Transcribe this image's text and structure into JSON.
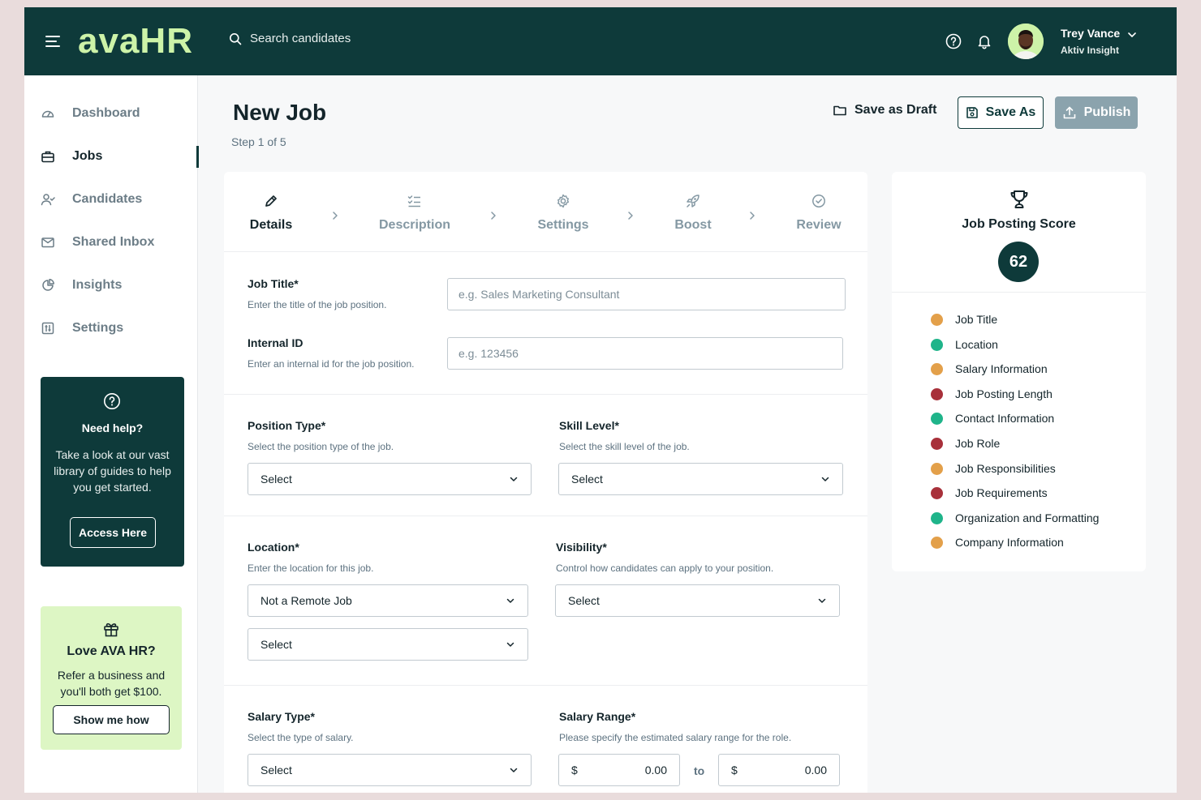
{
  "app": {
    "logo": "avaHR"
  },
  "header": {
    "search_placeholder": "Search candidates",
    "user": {
      "name": "Trey Vance",
      "org": "Aktiv Insight"
    }
  },
  "sidebar": {
    "items": [
      {
        "label": "Dashboard",
        "icon": "gauge-icon"
      },
      {
        "label": "Jobs",
        "icon": "briefcase-icon",
        "active": true
      },
      {
        "label": "Candidates",
        "icon": "user-check-icon"
      },
      {
        "label": "Shared Inbox",
        "icon": "mail-icon"
      },
      {
        "label": "Insights",
        "icon": "pie-chart-icon"
      },
      {
        "label": "Settings",
        "icon": "sliders-icon"
      }
    ],
    "help": {
      "title": "Need help?",
      "text": "Take a look at our vast library of guides to help you get started.",
      "button": "Access Here"
    },
    "refer": {
      "title": "Love AVA HR?",
      "text": "Refer a business and you'll both get $100.",
      "button": "Show me how"
    }
  },
  "page": {
    "title": "New Job",
    "step": "Step 1 of 5",
    "actions": {
      "draft": "Save as Draft",
      "save_as": "Save As",
      "publish": "Publish"
    }
  },
  "stepper": [
    {
      "label": "Details",
      "icon": "pen-icon",
      "active": true
    },
    {
      "label": "Description",
      "icon": "list-check-icon"
    },
    {
      "label": "Settings",
      "icon": "gear-icon"
    },
    {
      "label": "Boost",
      "icon": "rocket-icon"
    },
    {
      "label": "Review",
      "icon": "check-circle-icon"
    }
  ],
  "form": {
    "job_title": {
      "label": "Job Title*",
      "hint": "Enter the title of the job position.",
      "placeholder": "e.g. Sales Marketing Consultant"
    },
    "internal_id": {
      "label": "Internal ID",
      "hint": "Enter an internal id for the job position.",
      "placeholder": "e.g. 123456"
    },
    "position_type": {
      "label": "Position Type*",
      "hint": "Select the position type of the job.",
      "value": "Select"
    },
    "skill_level": {
      "label": "Skill Level*",
      "hint": "Select the skill level of the job.",
      "value": "Select"
    },
    "location": {
      "label": "Location*",
      "hint": "Enter the location for this job.",
      "value": "Not a Remote Job",
      "value2": "Select"
    },
    "visibility": {
      "label": "Visibility*",
      "hint": "Control how candidates can apply to your position.",
      "value": "Select"
    },
    "salary_type": {
      "label": "Salary Type*",
      "hint": "Select the type of salary.",
      "value": "Select"
    },
    "salary_range": {
      "label": "Salary Range*",
      "hint": "Please specify the estimated salary range for the role.",
      "currency": "$",
      "min": "0.00",
      "to": "to",
      "max": "0.00"
    }
  },
  "score": {
    "title": "Job Posting Score",
    "value": "62",
    "criteria": [
      {
        "label": "Job Title",
        "status": "warning",
        "color": "#e3a04a"
      },
      {
        "label": "Location",
        "status": "good",
        "color": "#1fb48a"
      },
      {
        "label": "Salary Information",
        "status": "warning",
        "color": "#e3a04a"
      },
      {
        "label": "Job Posting Length",
        "status": "bad",
        "color": "#a8303a"
      },
      {
        "label": "Contact Information",
        "status": "good",
        "color": "#1fb48a"
      },
      {
        "label": "Job Role",
        "status": "bad",
        "color": "#a8303a"
      },
      {
        "label": "Job Responsibilities",
        "status": "warning",
        "color": "#e3a04a"
      },
      {
        "label": "Job Requirements",
        "status": "bad",
        "color": "#a8303a"
      },
      {
        "label": "Organization and Formatting",
        "status": "good",
        "color": "#1fb48a"
      },
      {
        "label": "Company Information",
        "status": "warning",
        "color": "#e3a04a"
      }
    ]
  },
  "colors": {
    "brand_dark": "#0e3a3a",
    "brand_light": "#cdf3a8",
    "publish_disabled": "#8ba3ad"
  }
}
